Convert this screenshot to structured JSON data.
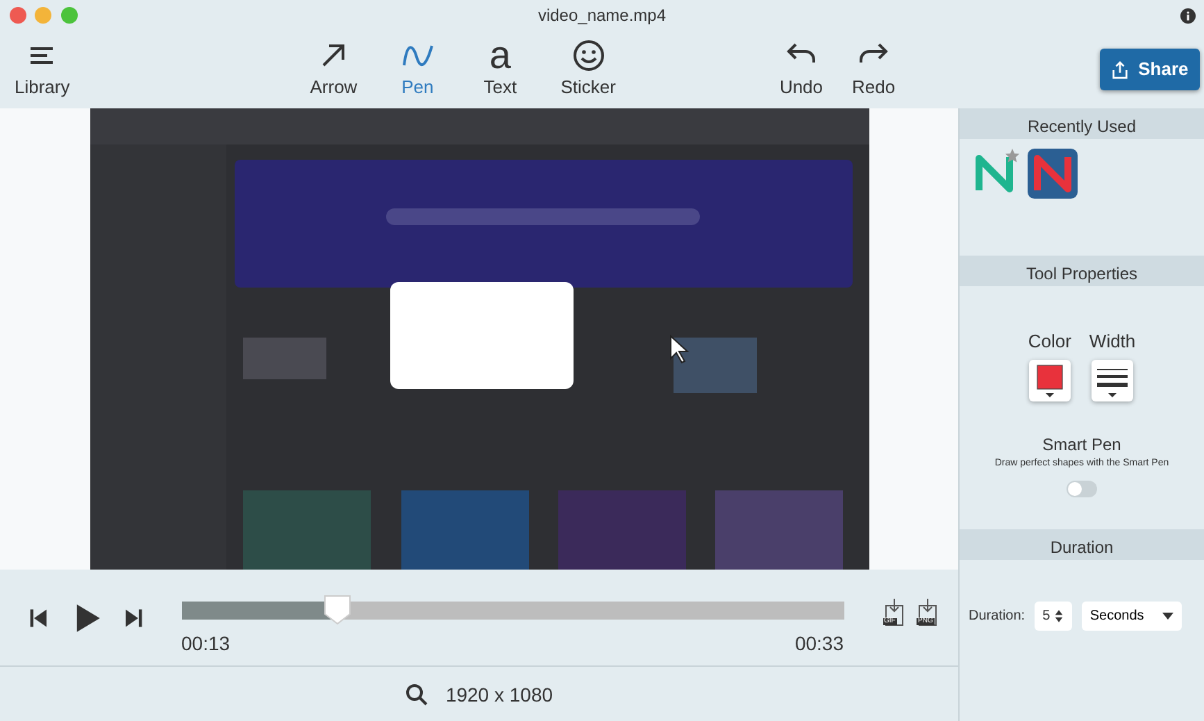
{
  "window": {
    "title": "video_name.mp4"
  },
  "toolbar": {
    "library": {
      "label": "Library"
    },
    "tools": [
      {
        "kind": "arrow",
        "label": "Arrow",
        "selected": false
      },
      {
        "kind": "pen",
        "label": "Pen",
        "selected": true
      },
      {
        "kind": "text",
        "label": "Text",
        "glyph": "a",
        "selected": false
      },
      {
        "kind": "sticker",
        "label": "Sticker",
        "selected": false
      }
    ],
    "history": [
      {
        "kind": "undo",
        "label": "Undo"
      },
      {
        "kind": "redo",
        "label": "Redo"
      }
    ],
    "share": {
      "label": "Share"
    }
  },
  "player": {
    "level": 0.235,
    "current": "00:13",
    "total": "00:33",
    "exports": [
      {
        "label": "GIF"
      },
      {
        "label": "PNG"
      }
    ]
  },
  "status_bar": {
    "resolution": "1920 x 1080"
  },
  "panel": {
    "recently_used": {
      "title": "Recently Used",
      "items": [
        {
          "color": "#1fb58f",
          "starred": true,
          "selected": false
        },
        {
          "color": "#e8323c",
          "starred": false,
          "selected": true
        }
      ]
    },
    "tool_properties": {
      "title": "Tool Properties",
      "color": {
        "label": "Color",
        "color": "#e8323c"
      },
      "width": {
        "label": "Width"
      },
      "smart_pen": {
        "title": "Smart Pen",
        "description": "Draw perfect shapes with the Smart Pen",
        "on": false
      }
    },
    "duration": {
      "title": "Duration",
      "label": "Duration:",
      "value": "5",
      "unit": "Seconds"
    }
  }
}
